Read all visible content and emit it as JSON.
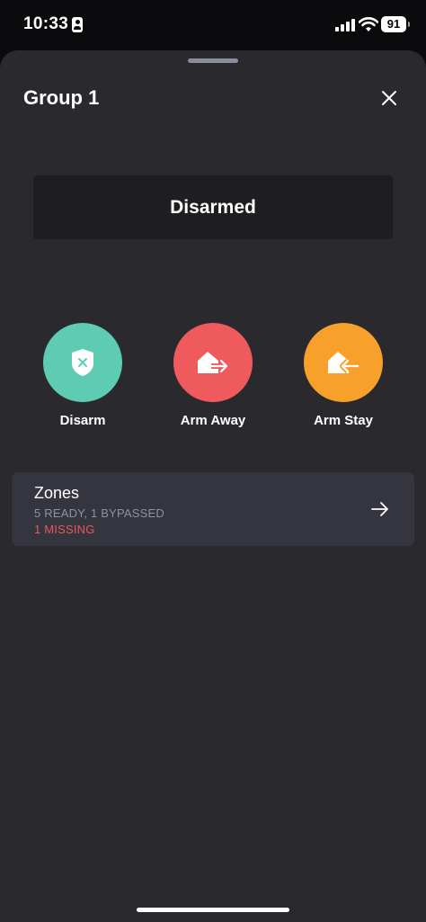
{
  "status_bar": {
    "time": "10:33",
    "battery": "91",
    "icons": [
      "id-card-icon",
      "signal-icon",
      "wifi-icon",
      "battery-icon"
    ]
  },
  "sheet": {
    "title": "Group 1",
    "close_icon": "close-icon"
  },
  "security_status": {
    "label": "Disarmed"
  },
  "actions": [
    {
      "label": "Disarm",
      "icon": "shield-x-icon",
      "color": "#5ecbb3"
    },
    {
      "label": "Arm Away",
      "icon": "house-arrow-out-icon",
      "color": "#ef5b5c"
    },
    {
      "label": "Arm Stay",
      "icon": "house-arrow-in-icon",
      "color": "#f8a02c"
    }
  ],
  "zones": {
    "title": "Zones",
    "summary": "5 READY, 1 BYPASSED",
    "missing": "1 MISSING",
    "missing_color": "#e65856",
    "icon": "arrow-right-icon"
  },
  "colors": {
    "sheet_background": "#2a2a2e",
    "card_background": "#1e1e21",
    "zones_background": "#353540"
  }
}
